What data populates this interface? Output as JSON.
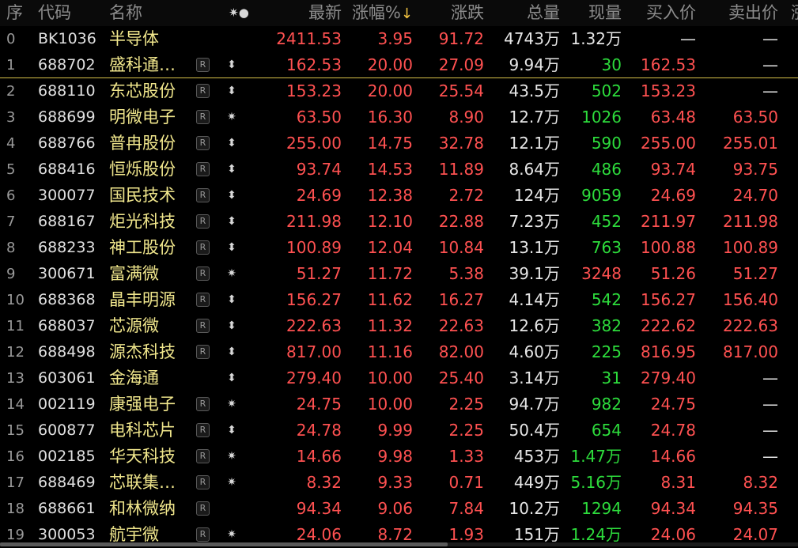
{
  "header": {
    "idx": "序",
    "code": "代码",
    "name": "名称",
    "flag": "✷●",
    "latest": "最新",
    "pct": "涨幅%",
    "pct_sort": "↓",
    "chg": "涨跌",
    "vol": "总量",
    "cur": "现量",
    "bid": "买入价",
    "ask": "卖出价",
    "more": "涨"
  },
  "colors": {
    "up": "#ff5151",
    "down": "#2ddc3c",
    "name": "#f0e68c",
    "accent": "#d8c24a"
  },
  "rows": [
    {
      "idx": "0",
      "code": "BK1036",
      "name": "半导体",
      "r": "",
      "flag": "",
      "latest": "2411.53",
      "pct": "3.95",
      "chg": "91.72",
      "vol": "4743万",
      "cur": "1.32万",
      "bid": "—",
      "ask": "—",
      "cur_color": "white",
      "bid_color": "white",
      "ask_color": "white"
    },
    {
      "idx": "1",
      "code": "688702",
      "name": "盛科通…",
      "r": "R",
      "flag": "⬍",
      "latest": "162.53",
      "pct": "20.00",
      "chg": "27.09",
      "vol": "9.94万",
      "cur": "30",
      "bid": "162.53",
      "ask": "—",
      "cur_color": "green",
      "bid_color": "red",
      "ask_color": "white"
    },
    {
      "idx": "2",
      "code": "688110",
      "name": "东芯股份",
      "r": "R",
      "flag": "⬍",
      "latest": "153.23",
      "pct": "20.00",
      "chg": "25.54",
      "vol": "43.5万",
      "cur": "502",
      "bid": "153.23",
      "ask": "—",
      "cur_color": "green",
      "bid_color": "red",
      "ask_color": "white"
    },
    {
      "idx": "3",
      "code": "688699",
      "name": "明微电子",
      "r": "R",
      "flag": "✷",
      "latest": "63.50",
      "pct": "16.30",
      "chg": "8.90",
      "vol": "12.7万",
      "cur": "1026",
      "bid": "63.48",
      "ask": "63.50",
      "cur_color": "green",
      "bid_color": "red",
      "ask_color": "red"
    },
    {
      "idx": "4",
      "code": "688766",
      "name": "普冉股份",
      "r": "R",
      "flag": "⬍",
      "latest": "255.00",
      "pct": "14.75",
      "chg": "32.78",
      "vol": "12.1万",
      "cur": "590",
      "bid": "255.00",
      "ask": "255.01",
      "cur_color": "green",
      "bid_color": "red",
      "ask_color": "red"
    },
    {
      "idx": "5",
      "code": "688416",
      "name": "恒烁股份",
      "r": "R",
      "flag": "⬍",
      "latest": "93.74",
      "pct": "14.53",
      "chg": "11.89",
      "vol": "8.64万",
      "cur": "486",
      "bid": "93.74",
      "ask": "93.75",
      "cur_color": "green",
      "bid_color": "red",
      "ask_color": "red"
    },
    {
      "idx": "6",
      "code": "300077",
      "name": "国民技术",
      "r": "R",
      "flag": "⬍",
      "latest": "24.69",
      "pct": "12.38",
      "chg": "2.72",
      "vol": "124万",
      "cur": "9059",
      "bid": "24.69",
      "ask": "24.70",
      "cur_color": "green",
      "bid_color": "red",
      "ask_color": "red"
    },
    {
      "idx": "7",
      "code": "688167",
      "name": "炬光科技",
      "r": "R",
      "flag": "⬍",
      "latest": "211.98",
      "pct": "12.10",
      "chg": "22.88",
      "vol": "7.23万",
      "cur": "452",
      "bid": "211.97",
      "ask": "211.98",
      "cur_color": "green",
      "bid_color": "red",
      "ask_color": "red"
    },
    {
      "idx": "8",
      "code": "688233",
      "name": "神工股份",
      "r": "R",
      "flag": "⬍",
      "latest": "100.89",
      "pct": "12.04",
      "chg": "10.84",
      "vol": "13.1万",
      "cur": "763",
      "bid": "100.88",
      "ask": "100.89",
      "cur_color": "green",
      "bid_color": "red",
      "ask_color": "red"
    },
    {
      "idx": "9",
      "code": "300671",
      "name": "富满微",
      "r": "R",
      "flag": "✷",
      "latest": "51.27",
      "pct": "11.72",
      "chg": "5.38",
      "vol": "39.1万",
      "cur": "3248",
      "bid": "51.26",
      "ask": "51.27",
      "cur_color": "red",
      "bid_color": "red",
      "ask_color": "red"
    },
    {
      "idx": "10",
      "code": "688368",
      "name": "晶丰明源",
      "r": "R",
      "flag": "⬍",
      "latest": "156.27",
      "pct": "11.62",
      "chg": "16.27",
      "vol": "4.14万",
      "cur": "542",
      "bid": "156.27",
      "ask": "156.40",
      "cur_color": "green",
      "bid_color": "red",
      "ask_color": "red"
    },
    {
      "idx": "11",
      "code": "688037",
      "name": "芯源微",
      "r": "R",
      "flag": "⬍",
      "latest": "222.63",
      "pct": "11.32",
      "chg": "22.63",
      "vol": "12.6万",
      "cur": "382",
      "bid": "222.62",
      "ask": "222.63",
      "cur_color": "green",
      "bid_color": "red",
      "ask_color": "red"
    },
    {
      "idx": "12",
      "code": "688498",
      "name": "源杰科技",
      "r": "R",
      "flag": "⬍",
      "latest": "817.00",
      "pct": "11.16",
      "chg": "82.00",
      "vol": "4.60万",
      "cur": "225",
      "bid": "816.95",
      "ask": "817.00",
      "cur_color": "green",
      "bid_color": "red",
      "ask_color": "red"
    },
    {
      "idx": "13",
      "code": "603061",
      "name": "金海通",
      "r": "",
      "flag": "⬍",
      "latest": "279.40",
      "pct": "10.00",
      "chg": "25.40",
      "vol": "3.14万",
      "cur": "31",
      "bid": "279.40",
      "ask": "—",
      "cur_color": "green",
      "bid_color": "red",
      "ask_color": "white"
    },
    {
      "idx": "14",
      "code": "002119",
      "name": "康强电子",
      "r": "R",
      "flag": "✷",
      "latest": "24.75",
      "pct": "10.00",
      "chg": "2.25",
      "vol": "94.7万",
      "cur": "982",
      "bid": "24.75",
      "ask": "—",
      "cur_color": "green",
      "bid_color": "red",
      "ask_color": "white"
    },
    {
      "idx": "15",
      "code": "600877",
      "name": "电科芯片",
      "r": "R",
      "flag": "⬍",
      "latest": "24.78",
      "pct": "9.99",
      "chg": "2.25",
      "vol": "50.4万",
      "cur": "654",
      "bid": "24.78",
      "ask": "—",
      "cur_color": "green",
      "bid_color": "red",
      "ask_color": "white"
    },
    {
      "idx": "16",
      "code": "002185",
      "name": "华天科技",
      "r": "R",
      "flag": "✷",
      "latest": "14.66",
      "pct": "9.98",
      "chg": "1.33",
      "vol": "453万",
      "cur": "1.47万",
      "bid": "14.66",
      "ask": "—",
      "cur_color": "green",
      "bid_color": "red",
      "ask_color": "white"
    },
    {
      "idx": "17",
      "code": "688469",
      "name": "芯联集…",
      "r": "R",
      "flag": "✷",
      "latest": "8.32",
      "pct": "9.33",
      "chg": "0.71",
      "vol": "449万",
      "cur": "5.16万",
      "bid": "8.31",
      "ask": "8.32",
      "cur_color": "green",
      "bid_color": "red",
      "ask_color": "red"
    },
    {
      "idx": "18",
      "code": "688661",
      "name": "和林微纳",
      "r": "R",
      "flag": "",
      "latest": "94.34",
      "pct": "9.06",
      "chg": "7.84",
      "vol": "10.2万",
      "cur": "1294",
      "bid": "94.34",
      "ask": "94.35",
      "cur_color": "green",
      "bid_color": "red",
      "ask_color": "red"
    },
    {
      "idx": "19",
      "code": "300053",
      "name": "航宇微",
      "r": "R",
      "flag": "✷",
      "latest": "24.06",
      "pct": "8.72",
      "chg": "1.93",
      "vol": "151万",
      "cur": "1.24万",
      "bid": "24.06",
      "ask": "24.07",
      "cur_color": "green",
      "bid_color": "red",
      "ask_color": "red"
    }
  ]
}
